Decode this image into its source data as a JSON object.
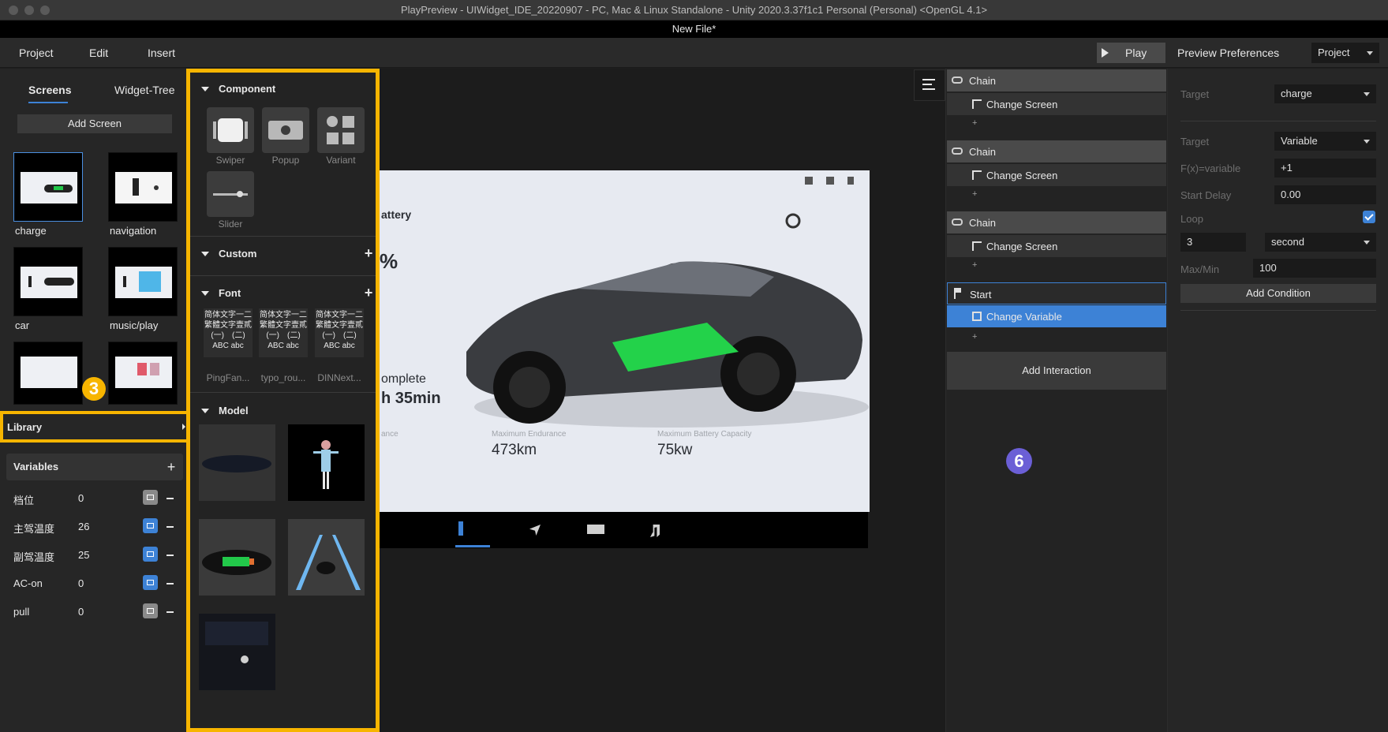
{
  "window": {
    "title": "PlayPreview - UIWidget_IDE_20220907 - PC, Mac & Linux Standalone - Unity 2020.3.37f1c1 Personal (Personal) <OpenGL 4.1>",
    "subtitle": "New File*"
  },
  "menu": {
    "project": "Project",
    "edit": "Edit",
    "insert": "Insert"
  },
  "toolbar": {
    "play": "Play",
    "preview_preferences": "Preview Preferences",
    "scope_select": "Project"
  },
  "left_panel": {
    "tabs": [
      "Screens",
      "Widget-Tree"
    ],
    "add_screen": "Add Screen",
    "screens": [
      "charge",
      "navigation",
      "car",
      "music/play"
    ]
  },
  "markers": {
    "left": "3",
    "right": "6"
  },
  "library": {
    "label": "Library"
  },
  "variables": {
    "title": "Variables",
    "items": [
      {
        "name": "档位",
        "value": "0",
        "linked": false
      },
      {
        "name": "主驾温度",
        "value": "26",
        "linked": true
      },
      {
        "name": "副驾温度",
        "value": "25",
        "linked": true
      },
      {
        "name": "AC-on",
        "value": "0",
        "linked": true
      },
      {
        "name": "pull",
        "value": "0",
        "linked": false
      }
    ]
  },
  "library_panel": {
    "component": {
      "title": "Component",
      "items": [
        "Swiper",
        "Popup",
        "Variant",
        "Slider"
      ]
    },
    "custom": {
      "title": "Custom"
    },
    "font": {
      "title": "Font",
      "sample_line1": "简体文字一二",
      "sample_line2": "繁體文字壹貳",
      "sample_line3": "(一)　(二)",
      "sample_line4": "ABC abc",
      "items": [
        "PingFan...",
        "typo_rou...",
        "DINNext..."
      ]
    },
    "model": {
      "title": "Model"
    }
  },
  "preview": {
    "battery_label": "attery",
    "percent": "%",
    "complete_label": "omplete",
    "time": "h 35min",
    "stat1_label": "ance",
    "stat2_label": "Maximum Endurance",
    "stat2_value": "473km",
    "stat3_label": "Maximum Battery Capacity",
    "stat3_value": "75kw"
  },
  "interactions": {
    "groups": [
      {
        "head": "Chain",
        "action": "Change Screen"
      },
      {
        "head": "Chain",
        "action": "Change Screen"
      },
      {
        "head": "Chain",
        "action": "Change Screen"
      },
      {
        "head": "Start",
        "action": "Change Variable"
      }
    ],
    "add_interaction": "Add Interaction"
  },
  "preferences": {
    "target_label": "Target",
    "target_value": "charge",
    "target2_label": "Target",
    "target2_value": "Variable",
    "fx_label": "F(x)=variable",
    "fx_value": "+1",
    "start_delay_label": "Start Delay",
    "start_delay_value": "0.00",
    "loop_label": "Loop",
    "loop_count": "3",
    "loop_unit": "second",
    "maxmin_label": "Max/Min",
    "maxmin_value": "100",
    "add_condition": "Add Condition"
  },
  "colors": {
    "highlight": "#f7b500",
    "accent": "#3d82d6",
    "battery": "#22c84a"
  }
}
